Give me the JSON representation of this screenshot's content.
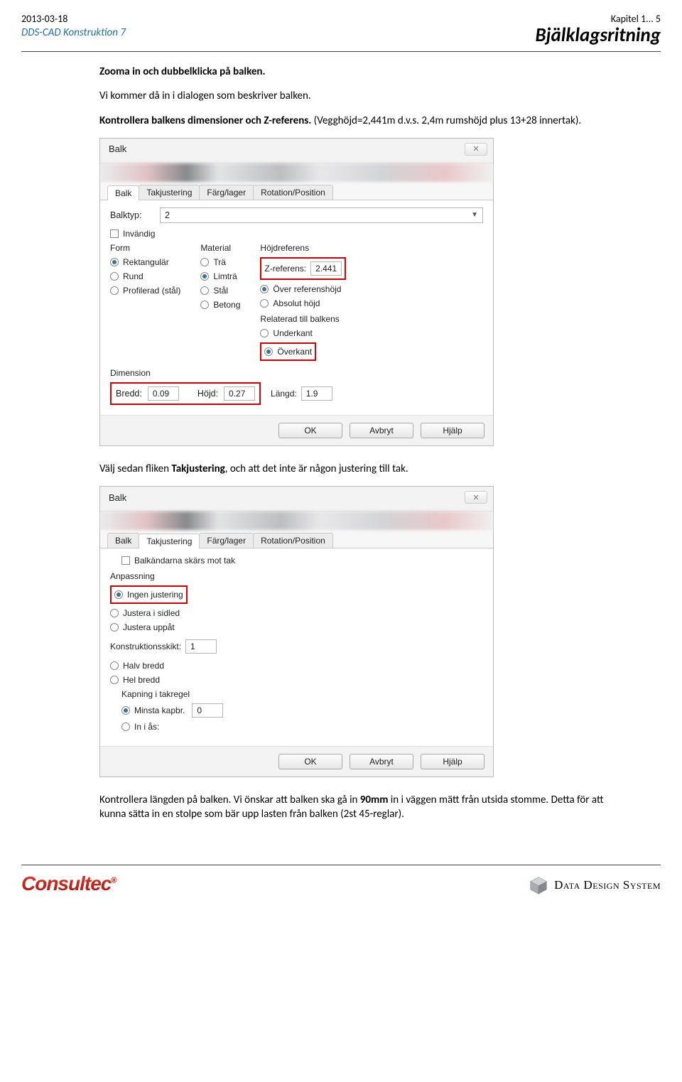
{
  "header": {
    "date": "2013-03-18",
    "product": "DDS-CAD Konstruktion 7",
    "chapter": "Kapitel 1... 5",
    "title": "Bjälklagsritning"
  },
  "body": {
    "p1": "Zooma in och dubbelklicka på balken.",
    "p2": "Vi kommer då in i dialogen som beskriver balken.",
    "p3a": "Kontrollera balkens dimensioner och Z-referens.",
    "p3b": " (Vegghöjd=2,441m d.v.s. 2,4m rumshöjd plus 13+28 innertak).",
    "p4a": "Välj sedan fliken ",
    "p4b": "Takjustering",
    "p4c": ", och att det inte är någon justering till tak.",
    "p5a": "Kontrollera längden på balken. Vi önskar att balken ska gå in ",
    "p5b": "90mm",
    "p5c": " in i väggen mätt från utsida stomme. Detta för att kunna sätta in en stolpe som bär upp lasten från balken (2st 45-reglar)."
  },
  "dialog1": {
    "title": "Balk",
    "tabs": [
      "Balk",
      "Takjustering",
      "Färg/lager",
      "Rotation/Position"
    ],
    "balktyp_label": "Balktyp:",
    "balktyp_value": "2",
    "invandig": "Invändig",
    "form_h": "Form",
    "form": {
      "rekt": "Rektangulär",
      "rund": "Rund",
      "prof": "Profilerad (stål)"
    },
    "material_h": "Material",
    "material": {
      "tra": "Trä",
      "limtra": "Limträ",
      "stal": "Stål",
      "betong": "Betong"
    },
    "hojd_h": "Höjdreferens",
    "zref_label": "Z-referens:",
    "zref_value": "2.441",
    "hojdopts": {
      "over": "Över referenshöjd",
      "abs": "Absolut höjd"
    },
    "relat_h": "Relaterad till balkens",
    "relat": {
      "under": "Underkant",
      "over": "Överkant"
    },
    "dim_h": "Dimension",
    "bredd_lbl": "Bredd:",
    "bredd": "0.09",
    "hojd_lbl": "Höjd:",
    "hojd": "0.27",
    "langd_lbl": "Längd:",
    "langd": "1.9",
    "ok": "OK",
    "avbryt": "Avbryt",
    "hjalp": "Hjälp"
  },
  "dialog2": {
    "title": "Balk",
    "tabs": [
      "Balk",
      "Takjustering",
      "Färg/lager",
      "Rotation/Position"
    ],
    "chk_skar": "Balkändarna skärs mot tak",
    "anp_h": "Anpassning",
    "anp": {
      "ingen": "Ingen justering",
      "sidled": "Justera i sidled",
      "uppat": "Justera uppåt"
    },
    "kskikt_lbl": "Konstruktionsskikt:",
    "kskikt": "1",
    "bredd": {
      "halv": "Halv bredd",
      "hel": "Hel bredd"
    },
    "kap_h": "Kapning i takregel",
    "kap": {
      "minsta": "Minsta kapbr.",
      "minsta_val": "0",
      "inas": "In i ås:"
    },
    "ok": "OK",
    "avbryt": "Avbryt",
    "hjalp": "Hjälp"
  },
  "footer": {
    "consultec": "Consultec",
    "dds": "Data Design System"
  }
}
